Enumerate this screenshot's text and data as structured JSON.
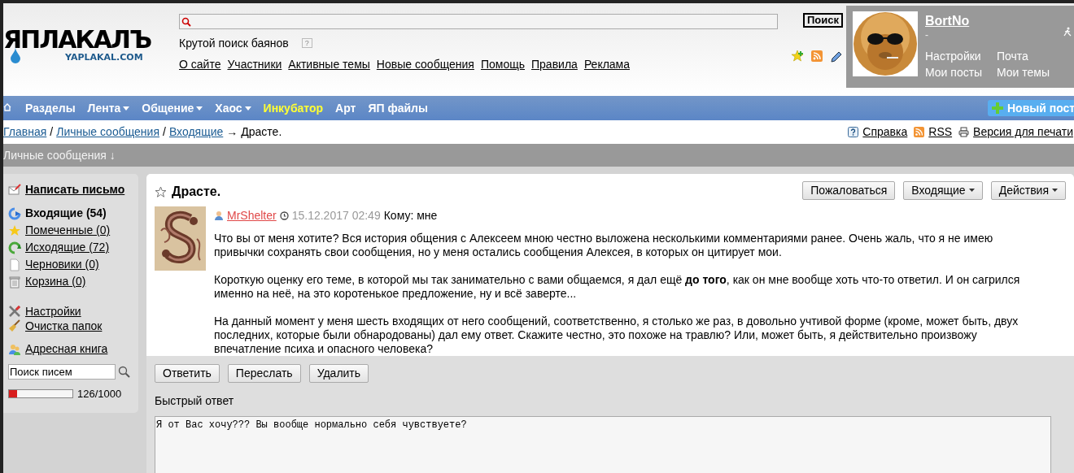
{
  "header": {
    "logo": {
      "title": "ЯПЛАКАЛЪ",
      "domain": "YAPLAKAL.COM"
    },
    "search": {
      "button": "Поиск",
      "hint": "Крутой поиск баянов",
      "help": "?"
    },
    "links": [
      "О сайте",
      "Участники",
      "Активные темы",
      "Новые сообщения",
      "Помощь",
      "Правила",
      "Реклама"
    ],
    "user": {
      "name": "BortNo",
      "status": "-",
      "links": [
        "Настройки",
        "Почта",
        "Мои посты",
        "Мои темы"
      ]
    }
  },
  "nav": {
    "items": [
      {
        "label": "Разделы",
        "has_menu": false,
        "highlighted": false
      },
      {
        "label": "Лента",
        "has_menu": true,
        "highlighted": false
      },
      {
        "label": "Общение",
        "has_menu": true,
        "highlighted": false
      },
      {
        "label": "Хаос",
        "has_menu": true,
        "highlighted": false
      },
      {
        "label": "Инкубатор",
        "has_menu": false,
        "highlighted": true
      },
      {
        "label": "Арт",
        "has_menu": false,
        "highlighted": false
      },
      {
        "label": "ЯП файлы",
        "has_menu": false,
        "highlighted": false
      }
    ],
    "new_post": "Новый пост"
  },
  "breadcrumb": {
    "links": [
      "Главная",
      "Личные сообщения",
      "Входящие"
    ],
    "separators": [
      "/",
      "/",
      "→"
    ],
    "current": "Драсте.",
    "tools": [
      "Справка",
      "RSS",
      "Версия для печати"
    ]
  },
  "section_title": "Личные сообщения ↓",
  "sidebar": {
    "compose": "Написать письмо",
    "folders": [
      {
        "label": "Входящие (54)",
        "selected": true,
        "kind": "inbox"
      },
      {
        "label": "Помеченные (0)",
        "selected": false,
        "kind": "starred"
      },
      {
        "label": "Исходящие (72)",
        "selected": false,
        "kind": "outbox"
      },
      {
        "label": "Черновики (0)",
        "selected": false,
        "kind": "drafts"
      },
      {
        "label": "Корзина (0)",
        "selected": false,
        "kind": "trash"
      }
    ],
    "tools": [
      {
        "label": "Настройки",
        "kind": "settings"
      },
      {
        "label": "Очистка папок",
        "kind": "broom"
      }
    ],
    "address_book": "Адресная книга",
    "search": {
      "value": "Поиск писем"
    },
    "quota": {
      "level": 0.13,
      "reading": "126/1000"
    }
  },
  "message": {
    "title": "Драсте.",
    "buttons": [
      "Пожаловаться",
      "Входящие",
      "Действия"
    ],
    "author": "MrShelter",
    "date": "15.12.2017 02:49",
    "recipient": "Кому: мне",
    "paragraphs": [
      "Что вы от меня хотите? Вся история общения с Алексеем мною честно выложена несколькими комментариями ранее. Очень жаль, что я не имею привычки сохранять свои сообщения, но у меня остались сообщения Алексея, в которых он цитирует мои.",
      "Короткую оценку его теме, в которой мы так занимательно с вами общаемся, я дал ещё **до того**, как он мне вообще хоть что-то ответил. И он сагрился именно на неё, на это коротенькое предложение, ну и всё заверте...",
      "На данный момент у меня шесть входящих от него сообщений, соответственно, я столько же раз, в довольно учтивой форме (кроме, может быть, двух последних, которые были обнародованы) дал ему ответ. Скажите честно, это похоже на травлю? Или, может быть, я действительно произвожу впечатление психа и опасного человека?"
    ],
    "actions": [
      "Ответить",
      "Переслать",
      "Удалить"
    ],
    "quick_reply": {
      "label": "Быстрый ответ",
      "value": "Я от Вас хочу??? Вы вообще нормально себя чувствуете?"
    }
  }
}
